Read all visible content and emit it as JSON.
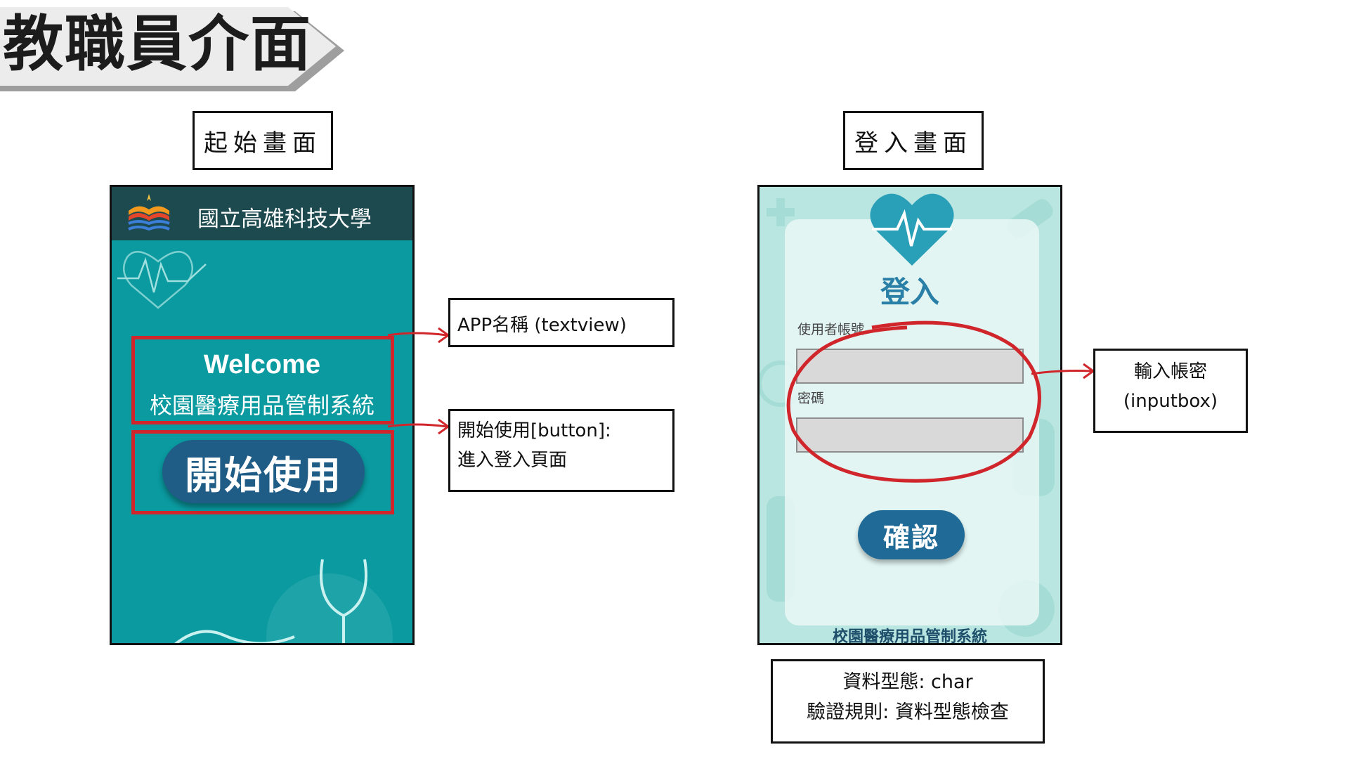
{
  "header": {
    "title": "教職員介面"
  },
  "start_screen": {
    "label": "起始畫面",
    "university_name": "國立高雄科技大學",
    "welcome_title": "Welcome",
    "app_name": "校園醫療用品管制系統",
    "start_button_label": "開始使用"
  },
  "login_screen": {
    "label": "登入畫面",
    "title": "登入",
    "username_label": "使用者帳號",
    "password_label": "密碼",
    "username_value": "",
    "password_value": "",
    "confirm_button_label": "確認",
    "footer_text": "校園醫療用品管制系統"
  },
  "annotations": {
    "app_name_note": "APP名稱 (textview)",
    "button_note_line1": "開始使用[button]:",
    "button_note_line2": "進入登入頁面",
    "input_note_line1": "輸入帳密",
    "input_note_line2": "(inputbox)",
    "data_type": "資料型態: char",
    "validation_rule": "驗證規則: 資料型態檢查"
  },
  "colors": {
    "start_bg": "#0a9aa0",
    "start_topbar": "#1d4a4f",
    "button_blue": "#1f5c86",
    "login_bg": "#b9e6e0",
    "login_title": "#2a7fa6",
    "highlight_red": "#d0262b"
  },
  "icons": [
    "university-logo-icon",
    "heartbeat-icon",
    "heart-pulse-icon",
    "stethoscope-icon"
  ]
}
